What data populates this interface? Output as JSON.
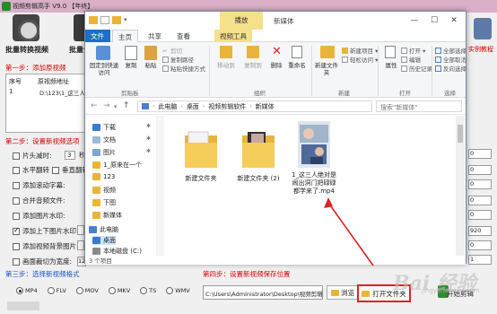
{
  "app": {
    "title": "视频剪辑高手 V9.0 【年终】",
    "batch_convert_label": "批量转换视频",
    "batch_merge_label": "批量合",
    "right_link_label": "实例教程",
    "step1_label": "第一步：添加原视频",
    "list_headers": [
      "序号",
      "原视频地址"
    ],
    "list_rows": [
      {
        "seq": "1",
        "path": "D:\\123\\1_这三人婉"
      }
    ],
    "step2_label": "第二步：设置新视频选项",
    "options": [
      {
        "label": "片头减时:",
        "checked": false
      },
      {
        "label": "水平翻转",
        "checked": false
      },
      {
        "label": "垂直翻转",
        "checked": false
      },
      {
        "label": "添加滚动字幕:",
        "checked": false
      },
      {
        "label": "合并音频文件:",
        "checked": false
      },
      {
        "label": "添加图片水印:",
        "checked": false
      },
      {
        "label": "添加上下图片水印:",
        "checked": true
      },
      {
        "label": "添加视频背景图片:",
        "checked": false
      },
      {
        "label": "画面裁切为宽度:",
        "checked": false
      }
    ],
    "fade_value": "3",
    "fade_unit": "秒",
    "crop_value": "1250",
    "right_fields": [
      "0",
      "0",
      "0",
      "0",
      "0",
      "920",
      "0",
      "1"
    ],
    "fps_label": "帧",
    "step3_label": "第三步：选择新视频格式",
    "formats": [
      {
        "label": "MP4",
        "selected": true
      },
      {
        "label": "FLV",
        "selected": false
      },
      {
        "label": "MOV",
        "selected": false
      },
      {
        "label": "MKV",
        "selected": false
      },
      {
        "label": "TS",
        "selected": false
      },
      {
        "label": "WMV",
        "selected": false
      }
    ],
    "step4_label": "第四步：设置新视频保存位置",
    "output_path": "C:\\Users\\Administrator\\Desktop\\视频剪辑",
    "browse_label": "浏览",
    "open_folder_label": "打开文件夹",
    "start_label": "开始剪辑"
  },
  "explorer": {
    "window_title": "新媒体",
    "context_tab_group": "播放",
    "tabs": [
      "文件",
      "主页",
      "共享",
      "查看",
      "视频工具"
    ],
    "ribbon": {
      "pin_quick_access": "固定到快速访问",
      "copy": "复制",
      "paste": "粘贴",
      "copy_path": "复制路径",
      "paste_shortcut": "粘贴快捷方式",
      "cut": "剪切",
      "move_to": "移动到",
      "copy_to": "复制到",
      "delete": "删除",
      "rename": "重命名",
      "new_folder": "新建文件夹",
      "new_item": "新建项目 ▾",
      "easy_access": "轻松访问 ▾",
      "properties": "属性",
      "open": "打开 ▾",
      "edit": "编辑",
      "history": "历史记录",
      "select_all": "全部选择",
      "select_none": "全部取消",
      "invert_selection": "反向选择",
      "group_clipboard": "剪贴板",
      "group_organize": "组织",
      "group_new": "新建",
      "group_open": "打开",
      "group_select": "选择"
    },
    "breadcrumb": [
      "此电脑",
      "桌面",
      "视频剪辑软件",
      "新媒体"
    ],
    "search_placeholder": "搜索\"新媒体\"",
    "nav_items": [
      {
        "label": "下载",
        "pinned": true
      },
      {
        "label": "文档",
        "pinned": true
      },
      {
        "label": "图片",
        "pinned": true
      },
      {
        "label": "1_原来在一个",
        "pinned": false
      },
      {
        "label": "123",
        "pinned": false
      },
      {
        "label": "视频",
        "pinned": false
      },
      {
        "label": "下图",
        "pinned": false
      },
      {
        "label": "新媒体",
        "pinned": false
      },
      {
        "label": "此电脑",
        "pinned": false
      },
      {
        "label": "桌面",
        "pinned": false
      },
      {
        "label": "本地磁盘 (C:)",
        "pinned": false
      },
      {
        "label": "本地磁盘 (D:)",
        "pinned": false
      }
    ],
    "files": [
      {
        "name": "新建文件夹",
        "type": "folder"
      },
      {
        "name": "新建文件夹 (2)",
        "type": "folder"
      },
      {
        "name": "1_这三人绝对是\n闹出洞门把碌碌\n都学来了.mp4",
        "type": "video"
      }
    ],
    "status": "3 个项目"
  },
  "annotation": {
    "arrow_color": "#e02020",
    "highlight_color": "#e02020"
  },
  "watermark": {
    "text": "Bai 经验",
    "sub": "jingyan.baidu.com"
  }
}
